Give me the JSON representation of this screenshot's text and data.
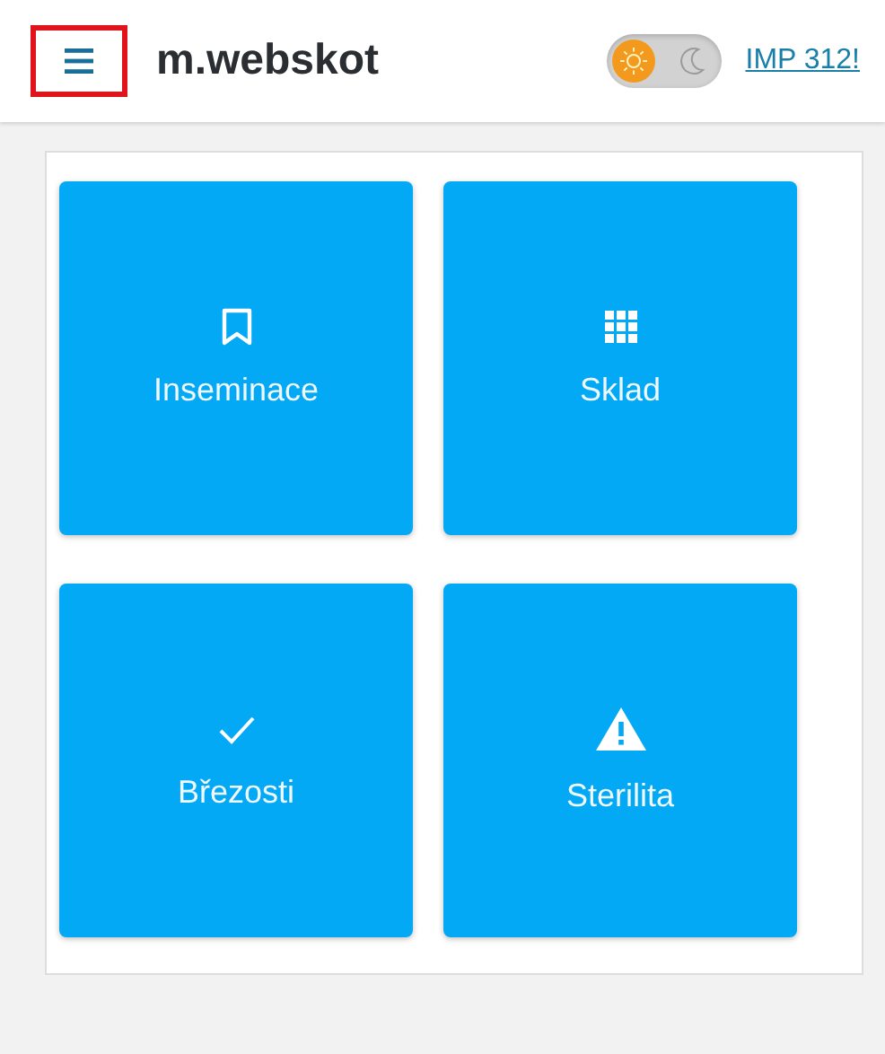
{
  "header": {
    "menu_highlighted": true,
    "title": "m.webskot",
    "dark_mode": false,
    "link": "IMP 312!"
  },
  "tiles": [
    {
      "kind": "bookmark",
      "label": "Inseminace"
    },
    {
      "kind": "grid",
      "label": "Sklad"
    },
    {
      "kind": "check",
      "label": "Březosti"
    },
    {
      "kind": "warning",
      "label": "Sterilita"
    }
  ]
}
